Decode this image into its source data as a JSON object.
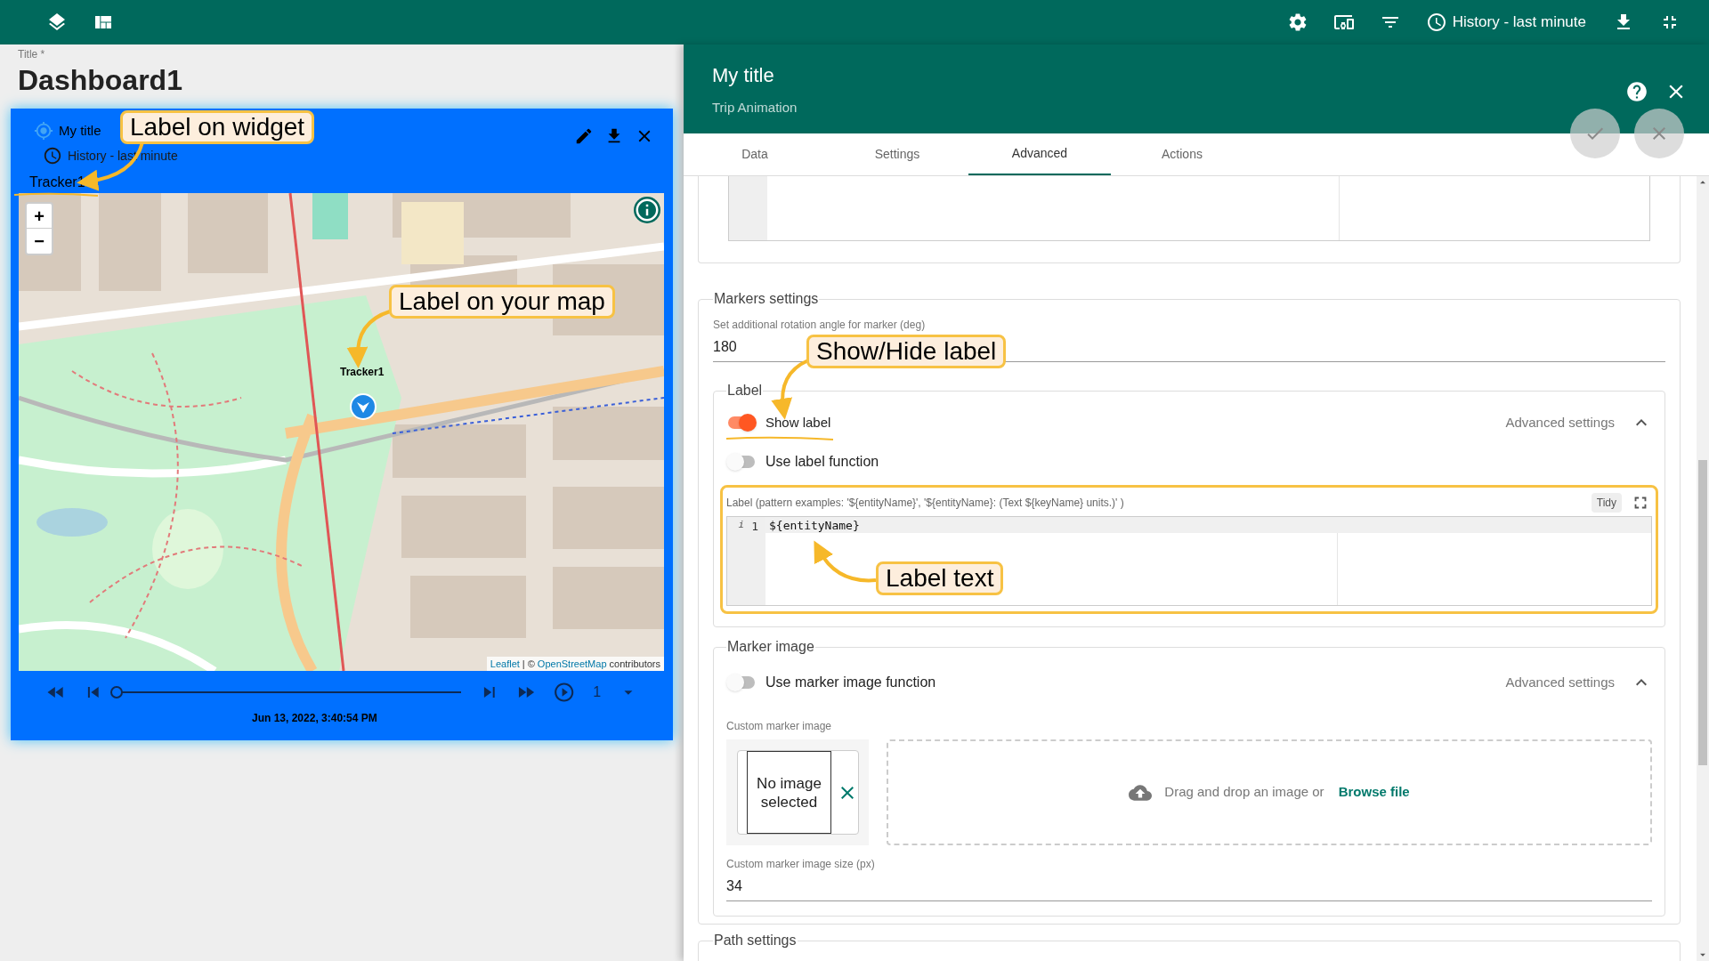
{
  "top_bar": {
    "timewindow": "History - last minute"
  },
  "dashboard": {
    "title_label": "Title *",
    "title": "Dashboard1"
  },
  "widget": {
    "title": "My title",
    "timewindow": "History - last minute",
    "label": "Tracker1",
    "map": {
      "zoom_in": "+",
      "zoom_out": "−",
      "marker_label": "Tracker1",
      "attribution": [
        {
          "text": "Leaflet",
          "kind": "link"
        },
        {
          "text": "| ©",
          "kind": "plain"
        },
        {
          "text": "OpenStreetMap",
          "kind": "link"
        },
        {
          "text": "contributors",
          "kind": "plain"
        }
      ]
    },
    "player": {
      "level": 0,
      "time": "Jun 13, 2022, 3:40:54 PM",
      "speed": "1"
    }
  },
  "panel": {
    "title": "My title",
    "subtitle": "Trip Animation",
    "tabs": [
      {
        "label": "Data",
        "selected": false
      },
      {
        "label": "Settings",
        "selected": false
      },
      {
        "label": "Advanced",
        "selected": true
      },
      {
        "label": "Actions",
        "selected": false
      }
    ],
    "markers_settings": {
      "legend": "Markers settings",
      "rotation": {
        "label": "Set additional rotation angle for marker (deg)",
        "value": "180"
      },
      "label": {
        "legend": "Label",
        "show_label": {
          "text": "Show label",
          "on": true
        },
        "advanced": "Advanced settings",
        "expanded": true,
        "use_function": {
          "text": "Use label function",
          "on": false
        },
        "pattern": {
          "label": "Label (pattern examples: '${entityName}', '${entityName}: (Text ${keyName} units.)' )",
          "tidy": "Tidy",
          "gutter_mark": "i",
          "line_number": "1",
          "code": "${entityName}"
        }
      },
      "marker_image": {
        "legend": "Marker image",
        "use_function": {
          "text": "Use marker image function",
          "on": false
        },
        "advanced": "Advanced settings",
        "expanded": true,
        "custom_label": "Custom marker image",
        "preview": "No image selected",
        "drop_text": "Drag and drop an image or",
        "browse": "Browse file",
        "size": {
          "label": "Custom marker image size (px)",
          "value": "34"
        }
      }
    },
    "path_settings": {
      "legend": "Path settings"
    }
  },
  "annotations": [
    {
      "text": "Label on widget"
    },
    {
      "text": "Label on your map"
    },
    {
      "text": "Show/Hide label"
    },
    {
      "text": "Label text"
    }
  ]
}
